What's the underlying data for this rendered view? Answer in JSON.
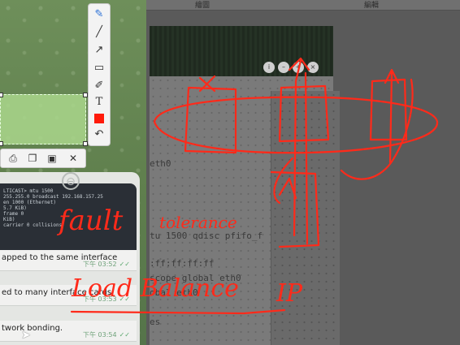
{
  "menubar": {
    "items": [
      "繪圖",
      "編輯"
    ]
  },
  "toolbar": {
    "tools": [
      "pen-tool",
      "line-tool",
      "arrow-tool",
      "rectangle-tool",
      "marker-tool",
      "text-tool",
      "color-swatch",
      "undo"
    ],
    "text_tool_glyph": "T",
    "color": "#ff1a0a",
    "bottom_actions": [
      "print",
      "copy",
      "save",
      "close"
    ]
  },
  "terminal": {
    "lines": [
      "LTICAST>  mtu 1500",
      " 255.255.0  broadcast 192.168.157.25",
      "en 1000  (Ethernet)",
      "5.7 KiB)",
      "  frame 0",
      " KiB)",
      "  carrier 0  collisions"
    ]
  },
  "messages": [
    {
      "text": "apped to the same interface",
      "time": "下午 03:52"
    },
    {
      "text": "ed to many interface cards.",
      "time": "下午 03:53"
    },
    {
      "text": "twork bonding.",
      "time": "下午 03:54"
    }
  ],
  "background_text": {
    "eth0": "eth0",
    "mtu": "tu 1500 qdisc pfifo_f",
    "mac": ":ff:ff:ff:ff",
    "scope": "scope global eth0",
    "global": "obal eth0",
    "es": "es"
  },
  "annotations": {
    "fault": "fault",
    "tolerance": "tolerance",
    "load_balance": "Load Balance",
    "ip": "IP"
  },
  "colors": {
    "ink": "#ff2a1a",
    "chat_bg": "#6e8f5a",
    "check": "#5aa76d"
  }
}
